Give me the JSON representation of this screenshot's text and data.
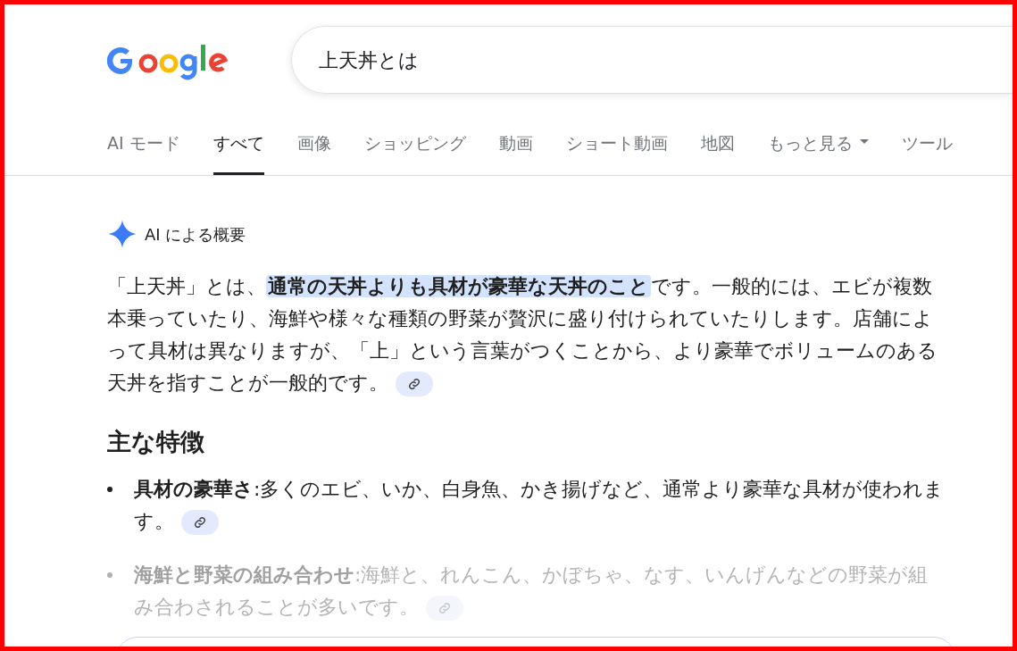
{
  "search": {
    "value": "上天丼とは"
  },
  "tabs": [
    {
      "label": "AI モード",
      "selected": false,
      "kind": "tab"
    },
    {
      "label": "すべて",
      "selected": true,
      "kind": "tab"
    },
    {
      "label": "画像",
      "selected": false,
      "kind": "tab"
    },
    {
      "label": "ショッピング",
      "selected": false,
      "kind": "tab"
    },
    {
      "label": "動画",
      "selected": false,
      "kind": "tab"
    },
    {
      "label": "ショート動画",
      "selected": false,
      "kind": "tab"
    },
    {
      "label": "地図",
      "selected": false,
      "kind": "tab"
    },
    {
      "label": "もっと見る",
      "selected": false,
      "kind": "menu"
    },
    {
      "label": "ツール",
      "selected": false,
      "kind": "tab"
    }
  ],
  "overview": {
    "title": "AI による概要",
    "segments": [
      {
        "text": "「上天丼」とは、",
        "highlighted": false
      },
      {
        "text": "通常の天丼よりも具材が豪華な天丼のこと",
        "highlighted": true
      },
      {
        "text": "です。一般的には、エビが複数本乗っていたり、海鮮や様々な種類の野菜が贅沢に盛り付けられていたりします。店舗によって具材は異なりますが、「上」という言葉がつくことから、より豪華でボリュームのある天丼を指すことが一般的です。",
        "highlighted": false
      }
    ],
    "heading": "主な特徴",
    "bullets": [
      {
        "term": "具材の豪華さ",
        "text": ":多くのエビ、いか、白身魚、かき揚げなど、通常より豪華な具材が使われます。",
        "faded": false
      },
      {
        "term": "海鮮と野菜の組み合わせ",
        "text": ":海鮮と、れんこん、かぼちゃ、なす、いんげんなどの野菜が組み合わされることが多いです。",
        "faded": true
      }
    ]
  }
}
